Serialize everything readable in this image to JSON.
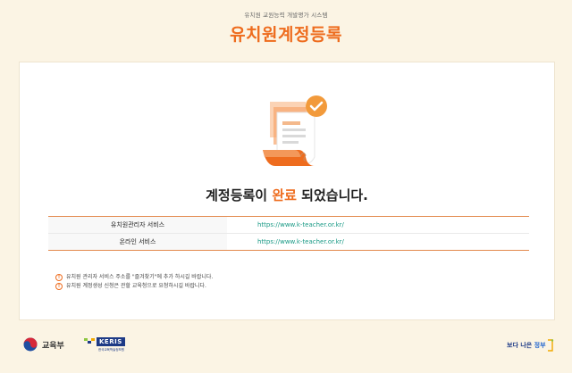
{
  "header": {
    "subtitle": "유치원 교원능력 개발평가 시스템",
    "title": "유치원계정등록"
  },
  "result": {
    "message_prefix": "계정등록이 ",
    "message_highlight": "완료",
    "message_suffix": " 되었습니다."
  },
  "services": [
    {
      "name": "유치원관리자 서비스",
      "url": "https://www.k-teacher.or.kr/"
    },
    {
      "name": "온라인 서비스",
      "url": "https://www.k-teacher.or.kr/"
    }
  ],
  "notes": [
    "유치원 관리자 서비스 주소를 \"즐겨찾기\"에 추가 하시길 바랍니다.",
    "유치원 계정생성 신청은 관할 교육청으로 요청하시길 바랍니다."
  ],
  "footer": {
    "moe_label": "교육부",
    "keris_label": "KERIS",
    "keris_sub": "한국교육학술정보원",
    "better_gov_prefix": "보다 나은 ",
    "better_gov_highlight": "정부"
  },
  "colors": {
    "accent": "#ee6c1e",
    "background": "#fbf4e4",
    "link": "#1a9a86",
    "brand_navy": "#1d3a86"
  }
}
